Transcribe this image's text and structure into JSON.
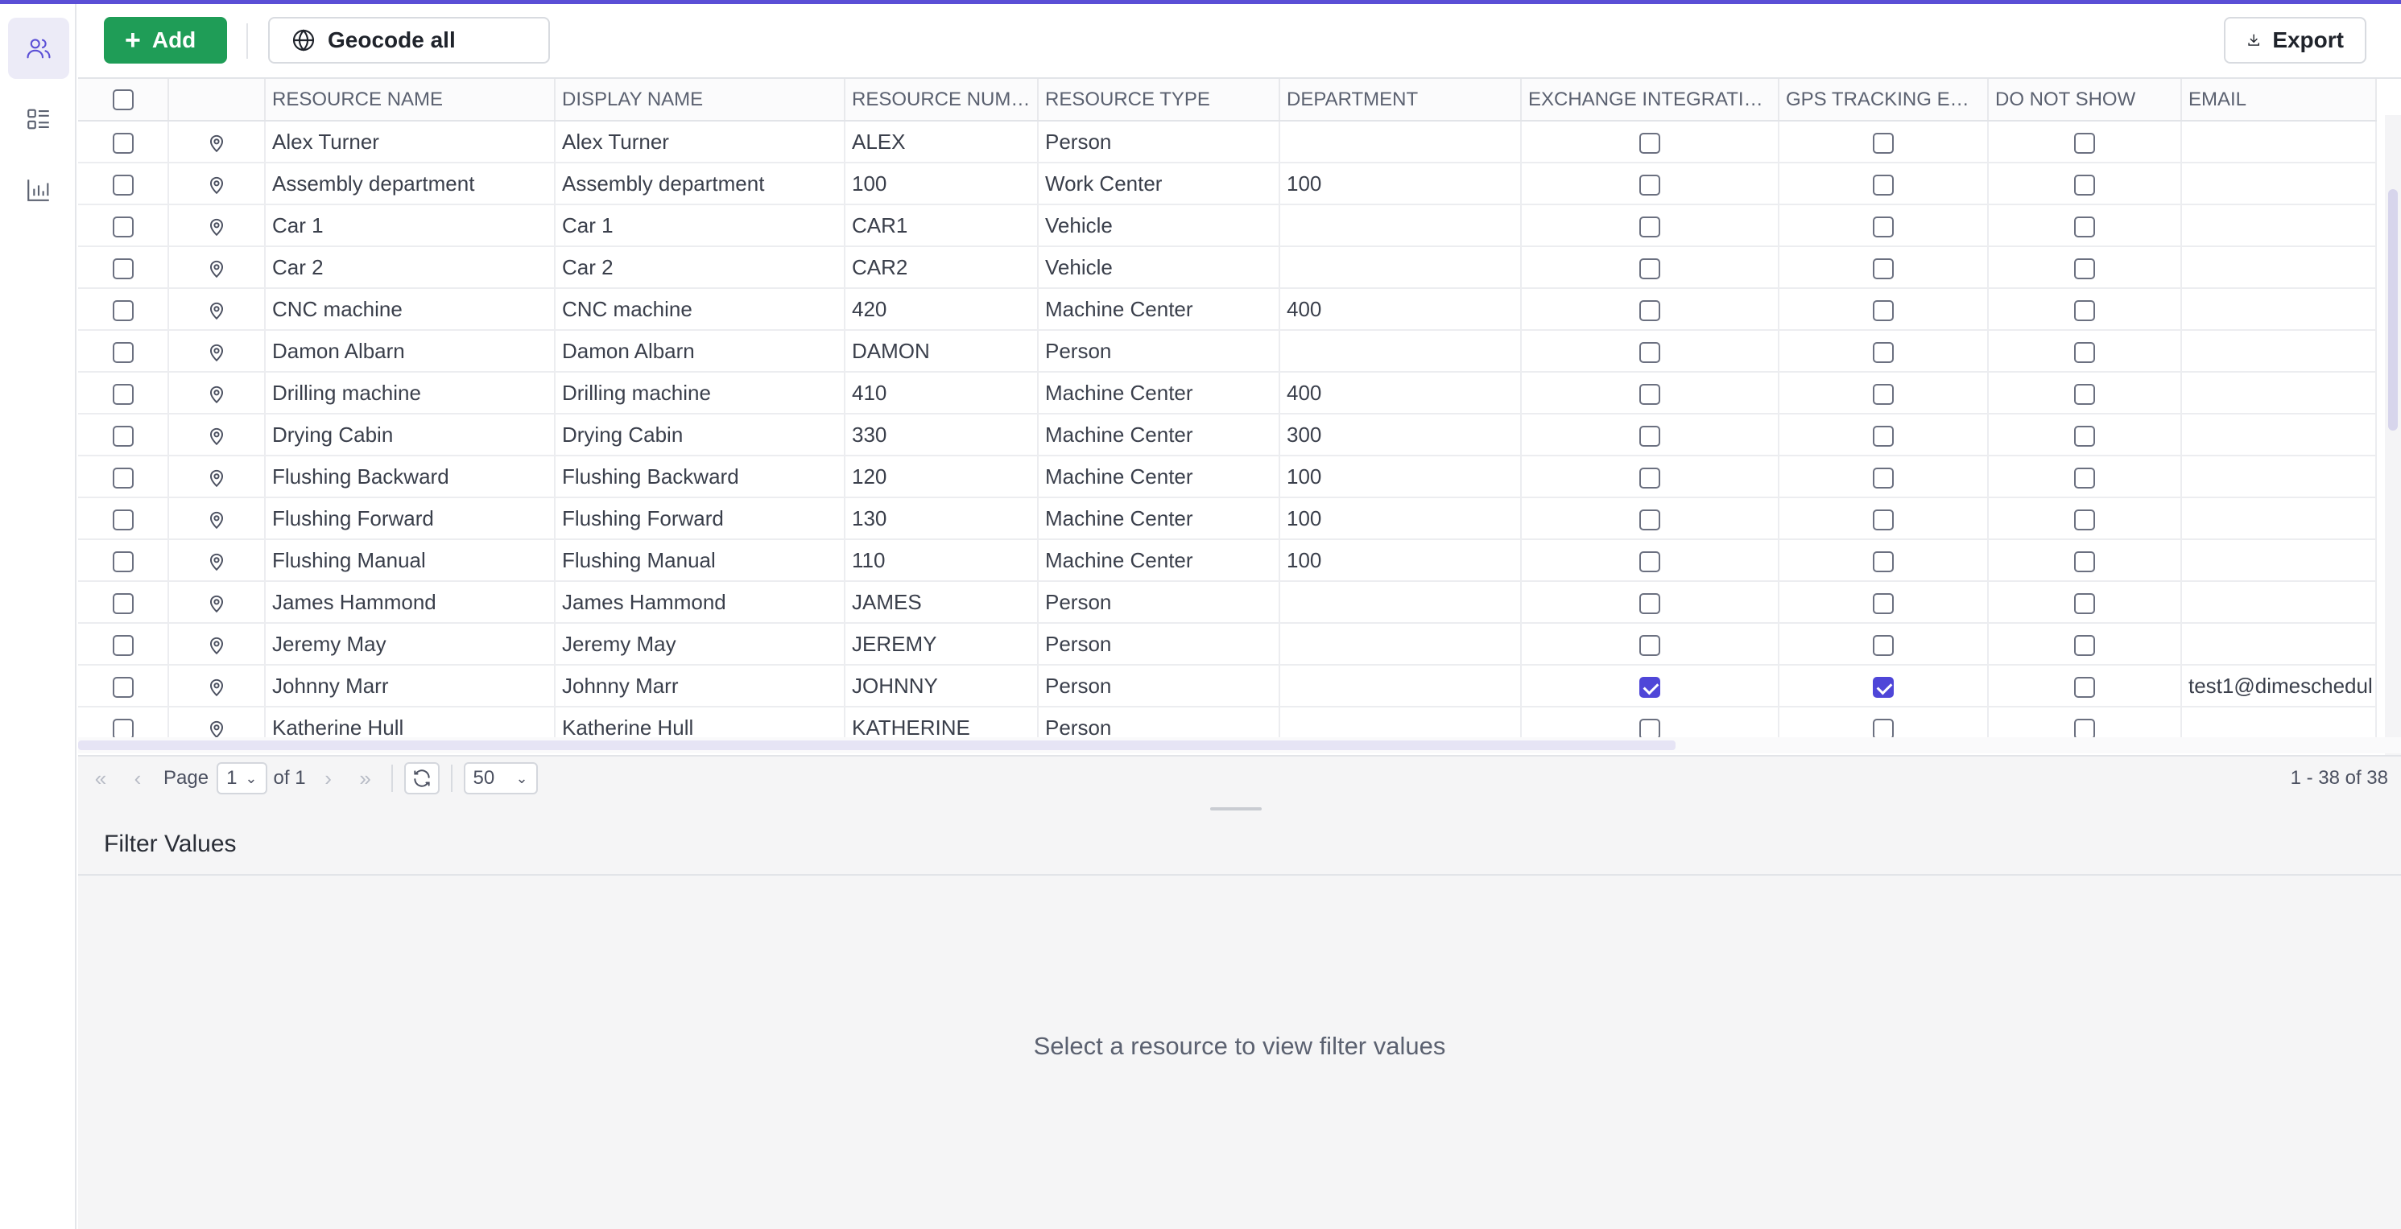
{
  "toolbar": {
    "add_label": "Add",
    "geocode_label": "Geocode all",
    "export_label": "Export"
  },
  "columns": [
    "RESOURCE NAME",
    "DISPLAY NAME",
    "RESOURCE NUMB...",
    "RESOURCE TYPE",
    "DEPARTMENT",
    "EXCHANGE INTEGRATIO...",
    "GPS TRACKING ENA...",
    "DO NOT SHOW",
    "EMAIL"
  ],
  "rows": [
    {
      "name": "Alex Turner",
      "display": "Alex Turner",
      "number": "ALEX",
      "type": "Person",
      "department": "",
      "exchange": false,
      "gps": false,
      "donotshow": false,
      "email": ""
    },
    {
      "name": "Assembly department",
      "display": "Assembly department",
      "number": "100",
      "type": "Work Center",
      "department": "100",
      "exchange": false,
      "gps": false,
      "donotshow": false,
      "email": ""
    },
    {
      "name": "Car 1",
      "display": "Car 1",
      "number": "CAR1",
      "type": "Vehicle",
      "department": "",
      "exchange": false,
      "gps": false,
      "donotshow": false,
      "email": ""
    },
    {
      "name": "Car 2",
      "display": "Car 2",
      "number": "CAR2",
      "type": "Vehicle",
      "department": "",
      "exchange": false,
      "gps": false,
      "donotshow": false,
      "email": ""
    },
    {
      "name": "CNC machine",
      "display": "CNC machine",
      "number": "420",
      "type": "Machine Center",
      "department": "400",
      "exchange": false,
      "gps": false,
      "donotshow": false,
      "email": ""
    },
    {
      "name": "Damon Albarn",
      "display": "Damon Albarn",
      "number": "DAMON",
      "type": "Person",
      "department": "",
      "exchange": false,
      "gps": false,
      "donotshow": false,
      "email": ""
    },
    {
      "name": "Drilling machine",
      "display": "Drilling machine",
      "number": "410",
      "type": "Machine Center",
      "department": "400",
      "exchange": false,
      "gps": false,
      "donotshow": false,
      "email": ""
    },
    {
      "name": "Drying Cabin",
      "display": "Drying Cabin",
      "number": "330",
      "type": "Machine Center",
      "department": "300",
      "exchange": false,
      "gps": false,
      "donotshow": false,
      "email": ""
    },
    {
      "name": "Flushing Backward",
      "display": "Flushing Backward",
      "number": "120",
      "type": "Machine Center",
      "department": "100",
      "exchange": false,
      "gps": false,
      "donotshow": false,
      "email": ""
    },
    {
      "name": "Flushing Forward",
      "display": "Flushing Forward",
      "number": "130",
      "type": "Machine Center",
      "department": "100",
      "exchange": false,
      "gps": false,
      "donotshow": false,
      "email": ""
    },
    {
      "name": "Flushing Manual",
      "display": "Flushing Manual",
      "number": "110",
      "type": "Machine Center",
      "department": "100",
      "exchange": false,
      "gps": false,
      "donotshow": false,
      "email": ""
    },
    {
      "name": "James Hammond",
      "display": "James Hammond",
      "number": "JAMES",
      "type": "Person",
      "department": "",
      "exchange": false,
      "gps": false,
      "donotshow": false,
      "email": ""
    },
    {
      "name": "Jeremy May",
      "display": "Jeremy May",
      "number": "JEREMY",
      "type": "Person",
      "department": "",
      "exchange": false,
      "gps": false,
      "donotshow": false,
      "email": ""
    },
    {
      "name": "Johnny Marr",
      "display": "Johnny Marr",
      "number": "JOHNNY",
      "type": "Person",
      "department": "",
      "exchange": true,
      "gps": true,
      "donotshow": false,
      "email": "test1@dimeschedul"
    },
    {
      "name": "Katherine Hull",
      "display": "Katherine Hull",
      "number": "KATHERINE",
      "type": "Person",
      "department": "",
      "exchange": false,
      "gps": false,
      "donotshow": false,
      "email": ""
    }
  ],
  "pager": {
    "page_label": "Page",
    "page_value": "1",
    "of_label": "of 1",
    "page_size": "50",
    "range": "1 - 38 of 38"
  },
  "filter_panel": {
    "title": "Filter Values",
    "empty_message": "Select a resource to view filter values"
  },
  "colors": {
    "accent": "#5b4fd6",
    "add_button": "#1f9d57",
    "checkbox_checked": "#4f46d8"
  }
}
